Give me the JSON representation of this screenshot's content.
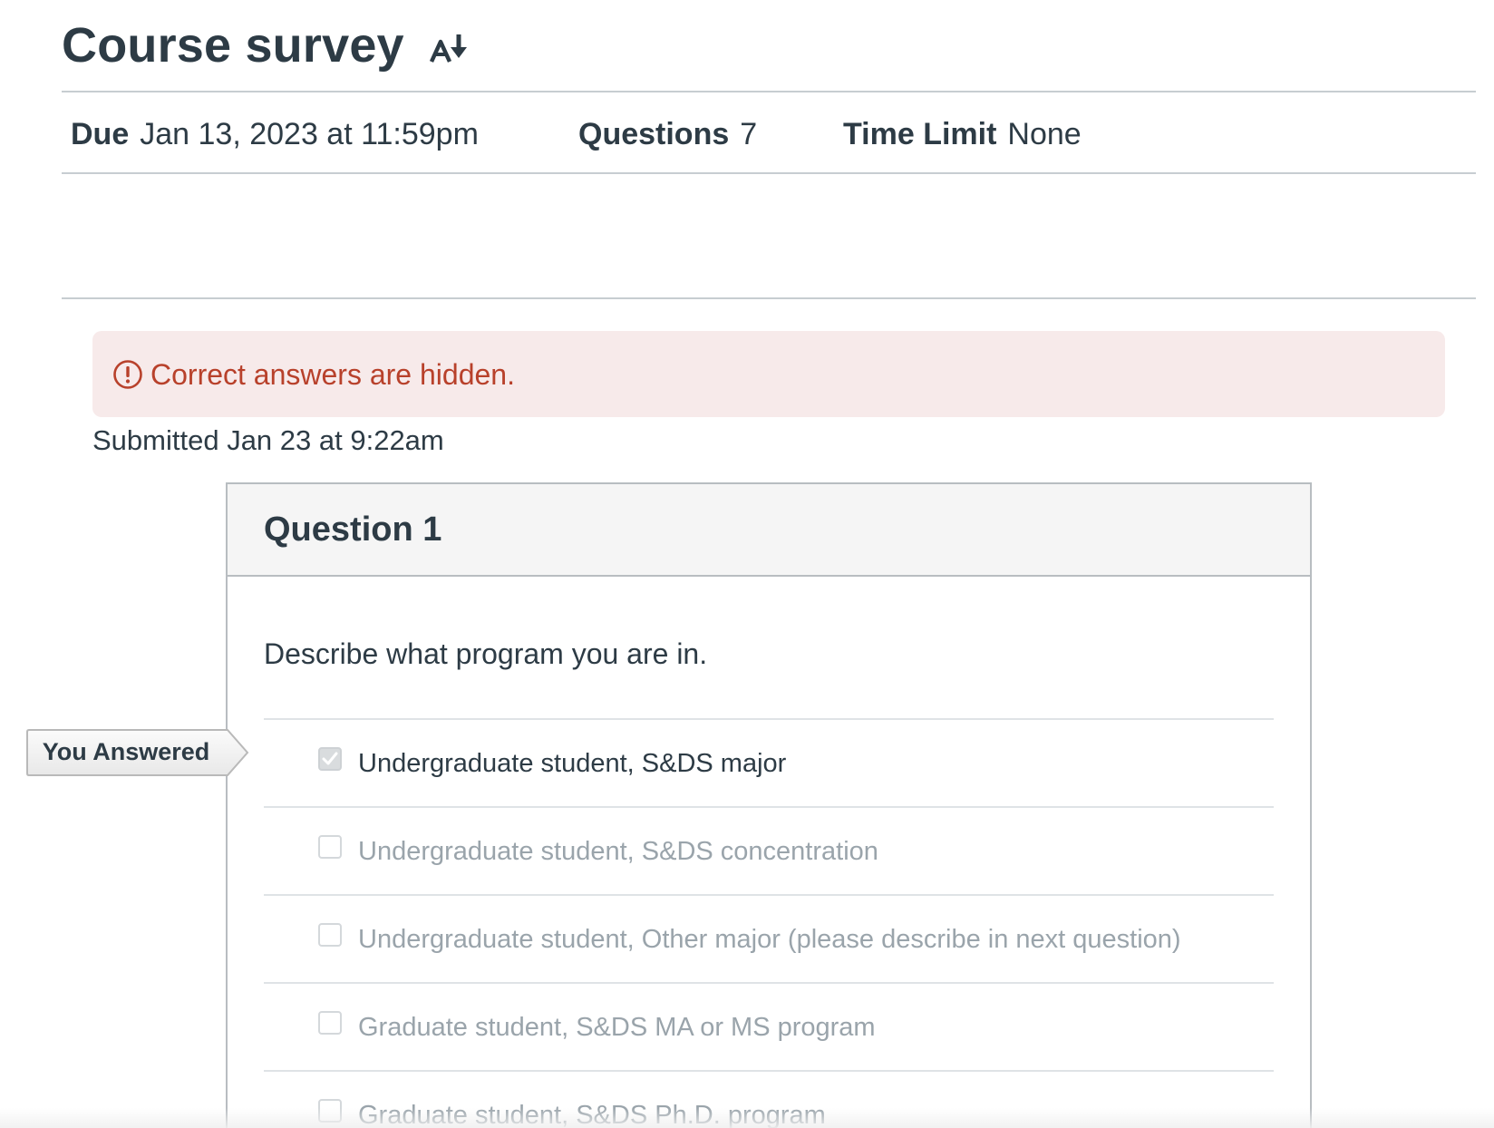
{
  "header": {
    "title": "Course survey",
    "translate_icon": "translate-icon"
  },
  "details": {
    "due_label": "Due",
    "due_value": "Jan 13, 2023 at 11:59pm",
    "questions_label": "Questions",
    "questions_value": "7",
    "time_limit_label": "Time Limit",
    "time_limit_value": "None"
  },
  "alert": {
    "icon": "warning-circle-icon",
    "text": "Correct answers are hidden.",
    "color": "#b8412b",
    "background": "#f7eaea"
  },
  "submitted": "Submitted Jan 23 at 9:22am",
  "question": {
    "title": "Question 1",
    "text": "Describe what program you are in.",
    "you_answered_label": "You Answered",
    "answers": [
      {
        "label": "Undergraduate student, S&DS major",
        "checked": true
      },
      {
        "label": "Undergraduate student, S&DS concentration",
        "checked": false
      },
      {
        "label": "Undergraduate student, Other major (please describe in next question)",
        "checked": false
      },
      {
        "label": "Graduate student, S&DS MA or MS program",
        "checked": false
      },
      {
        "label": "Graduate student, S&DS Ph.D. program",
        "checked": false
      }
    ]
  }
}
